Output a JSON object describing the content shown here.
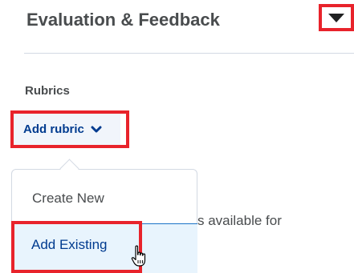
{
  "section": {
    "title": "Evaluation & Feedback",
    "toggle_icon": "triangle-down-icon"
  },
  "rubrics": {
    "label": "Rubrics",
    "add_button_label": "Add rubric",
    "add_button_icon": "chevron-down-icon"
  },
  "menu": {
    "items": [
      {
        "label": "Create New"
      },
      {
        "label": "Add Existing"
      }
    ]
  },
  "background_text": "s available for",
  "cursor_icon": "hand-pointer-icon",
  "colors": {
    "highlight_border": "#e8232b",
    "link_blue": "#003b8f",
    "text_gray": "#494c4e",
    "selected_bg": "#e8f4fd"
  }
}
